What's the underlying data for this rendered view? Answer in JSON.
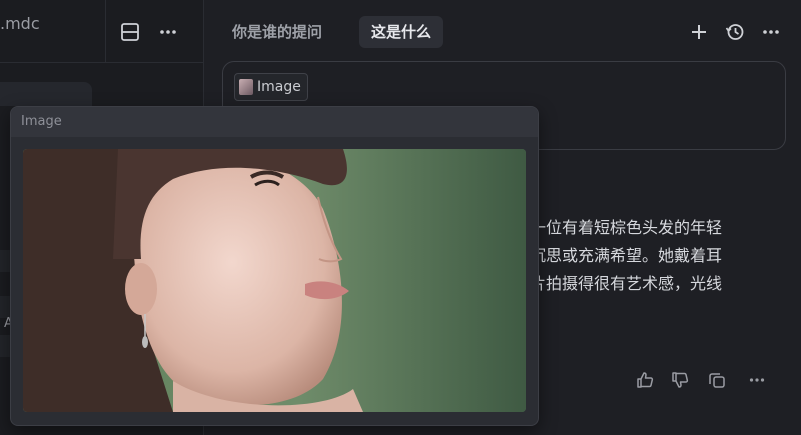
{
  "left_panel": {
    "file_tab_label": ".mdc",
    "glyph_fragment": "A"
  },
  "toolbar": {
    "icons": {
      "split": "split-view-icon",
      "more": "more-icon",
      "add": "plus-icon",
      "history": "history-icon"
    }
  },
  "tabs": [
    {
      "label": "你是谁的提问",
      "active": false
    },
    {
      "label": "这是什么",
      "active": true
    }
  ],
  "input": {
    "attachment_label": "Image"
  },
  "answer": {
    "lines": [
      "是一位有着短棕色头发的年轻",
      "乎沉思或充满希望。她戴着耳",
      "照片拍摄得很有艺术感，光线"
    ]
  },
  "actions": {
    "icons": [
      "thumbs-up-icon",
      "thumbs-down-icon",
      "copy-icon",
      "more-icon"
    ]
  },
  "preview": {
    "title": "Image"
  },
  "colors": {
    "background": "#1e1f24",
    "sidebar": "#1b1c20",
    "active_tab": "#2d2f36",
    "popup": "#2b2d33"
  }
}
